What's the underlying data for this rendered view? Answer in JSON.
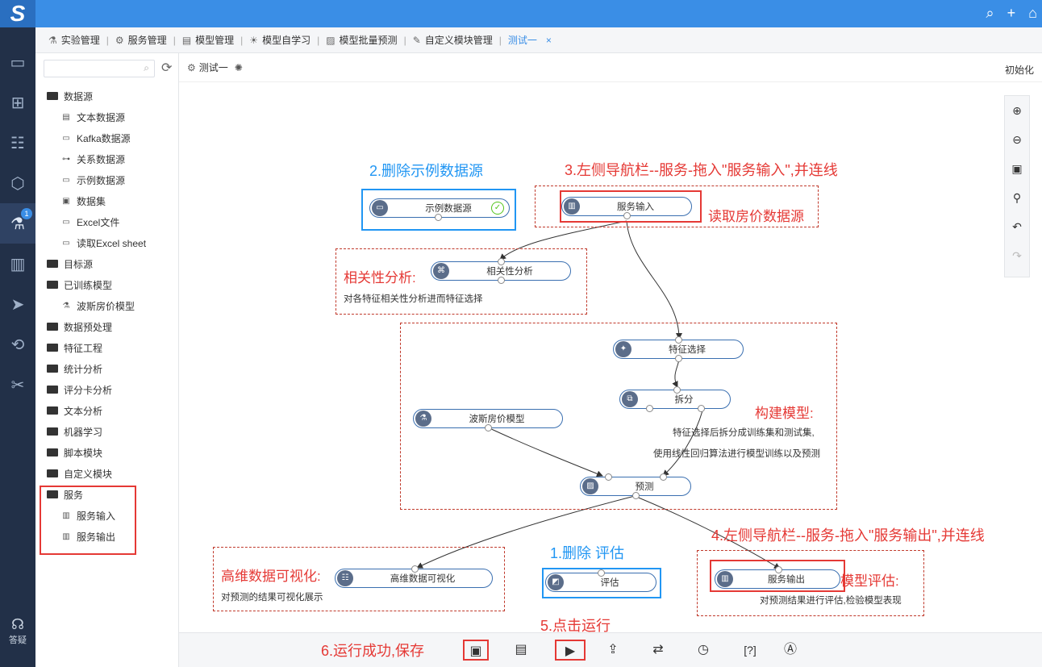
{
  "app": {
    "logo": "S",
    "top_icons": [
      "search-icon",
      "plus-icon",
      "home-icon"
    ]
  },
  "leftnav": {
    "badge": "1",
    "help_label": "答疑"
  },
  "tabs": [
    {
      "label": "实验管理",
      "icon": "flask-icon"
    },
    {
      "label": "服务管理",
      "icon": "service-icon"
    },
    {
      "label": "模型管理",
      "icon": "chart-icon"
    },
    {
      "label": "模型自学习",
      "icon": "bulb-icon"
    },
    {
      "label": "模型批量预测",
      "icon": "linechart-icon"
    },
    {
      "label": "自定义模块管理",
      "icon": "edit-icon"
    },
    {
      "label": "测试一",
      "icon": ""
    }
  ],
  "tab_close": "×",
  "sidebar": {
    "search_placeholder": "",
    "tree": [
      {
        "label": "数据源",
        "type": "folder",
        "children": [
          "文本数据源",
          "Kafka数据源",
          "关系数据源",
          "示例数据源",
          "数据集",
          "Excel文件",
          "读取Excel sheet"
        ]
      },
      {
        "label": "目标源",
        "type": "folder"
      },
      {
        "label": "已训练模型",
        "type": "folder",
        "children": [
          "波斯房价模型"
        ]
      },
      {
        "label": "数据预处理",
        "type": "folder"
      },
      {
        "label": "特征工程",
        "type": "folder"
      },
      {
        "label": "统计分析",
        "type": "folder"
      },
      {
        "label": "评分卡分析",
        "type": "folder"
      },
      {
        "label": "文本分析",
        "type": "folder"
      },
      {
        "label": "机器学习",
        "type": "folder"
      },
      {
        "label": "脚本模块",
        "type": "folder"
      },
      {
        "label": "自定义模块",
        "type": "folder"
      },
      {
        "label": "服务",
        "type": "folder",
        "children": [
          "服务输入",
          "服务输出"
        ]
      }
    ]
  },
  "canvas_head": {
    "title": "测试一",
    "init_label": "初始化"
  },
  "nodes": {
    "sample_source": "示例数据源",
    "service_input": "服务输入",
    "correlation": "相关性分析",
    "feature_select": "特征选择",
    "split": "拆分",
    "boston_model": "波斯房价模型",
    "predict": "预测",
    "hd_vis": "高维数据可视化",
    "evaluate": "评估",
    "service_output": "服务输出"
  },
  "annotations": {
    "delete_sample": "2.删除示例数据源",
    "drag_input": "3.左侧导航栏--服务-拖入\"服务输入\",并连线",
    "read_house": "读取房价数据源",
    "corr_title": "相关性分析:",
    "corr_desc": "对各特征相关性分析进而特征选择",
    "build_title": "构建模型:",
    "build_desc1": "特征选择后拆分成训练集和测试集,",
    "build_desc2": "使用线性回归算法进行模型训练以及预测",
    "drag_output": "4.左侧导航栏--服务-拖入\"服务输出\",并连线",
    "delete_eval": "1.删除 评估",
    "vis_title": "高维数据可视化:",
    "vis_desc": "对预测的结果可视化展示",
    "eval_title": "模型评估:",
    "eval_desc": "对预测结果进行评估,检验模型表现",
    "run": "5.点击运行",
    "save": "6.运行成功,保存"
  },
  "bottom_tools": [
    "save-icon",
    "save-as-icon",
    "run-icon",
    "export-icon",
    "switch-icon",
    "schedule-icon",
    "help-bracket-icon",
    "publish-icon"
  ],
  "bottom_help_label": "[?]",
  "colors": {
    "accent": "#3a8ee6",
    "nav_bg": "#223048",
    "annot_red": "#e53935",
    "annot_blue": "#2196f3"
  }
}
